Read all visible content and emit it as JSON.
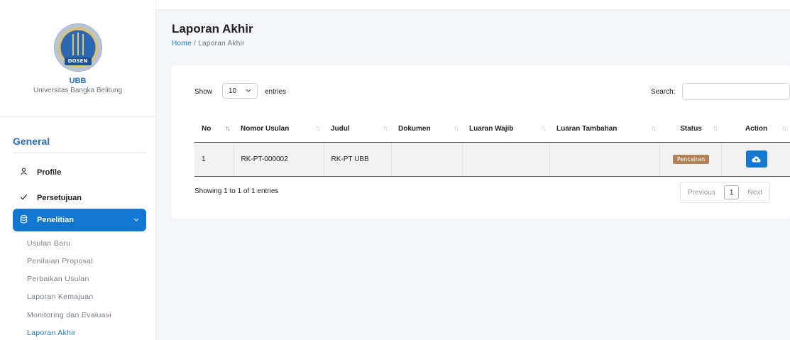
{
  "brand": {
    "logo_text": "DOSEN",
    "name": "UBB",
    "subtitle": "Universitas Bangka Belitung"
  },
  "sidebar": {
    "section_title": "General",
    "items": [
      {
        "label": "Profile",
        "icon": "user-icon"
      },
      {
        "label": "Persetujuan",
        "icon": "check-icon"
      },
      {
        "label": "Penelitian",
        "icon": "database-icon",
        "active": true
      }
    ],
    "sub_items": [
      {
        "label": "Usulan Baru"
      },
      {
        "label": "Penilaian Proposal"
      },
      {
        "label": "Perbaikan Usulan"
      },
      {
        "label": "Laporan Kemajuan"
      },
      {
        "label": "Monitoring dan Evaluasi"
      },
      {
        "label": "Laporan Akhir",
        "active": true
      }
    ]
  },
  "page": {
    "title": "Laporan Akhir",
    "breadcrumb": {
      "home": "Home",
      "separator": "/",
      "current": "Laporan Akhir"
    }
  },
  "table_controls": {
    "show_label": "Show",
    "length_value": "10",
    "entries_label": "entries",
    "search_label": "Search:",
    "search_value": ""
  },
  "table": {
    "columns": [
      "No",
      "Nomor Usulan",
      "Judul",
      "Dokumen",
      "Luaran Wajib",
      "Luaran Tambahan",
      "Status",
      "Action"
    ],
    "rows": [
      {
        "no": "1",
        "nomor_usulan": "RK-PT-000002",
        "judul": "RK-PT UBB",
        "dokumen": "",
        "luaran_wajib": "",
        "luaran_tambahan": "",
        "status": "Pencairan",
        "action_icon": "cloud-upload-icon"
      }
    ]
  },
  "footer": {
    "info": "Showing 1 to 1 of 1 entries",
    "previous": "Previous",
    "current_page": "1",
    "next": "Next"
  },
  "colors": {
    "primary": "#1177d1",
    "status_badge": "#b5835a"
  }
}
